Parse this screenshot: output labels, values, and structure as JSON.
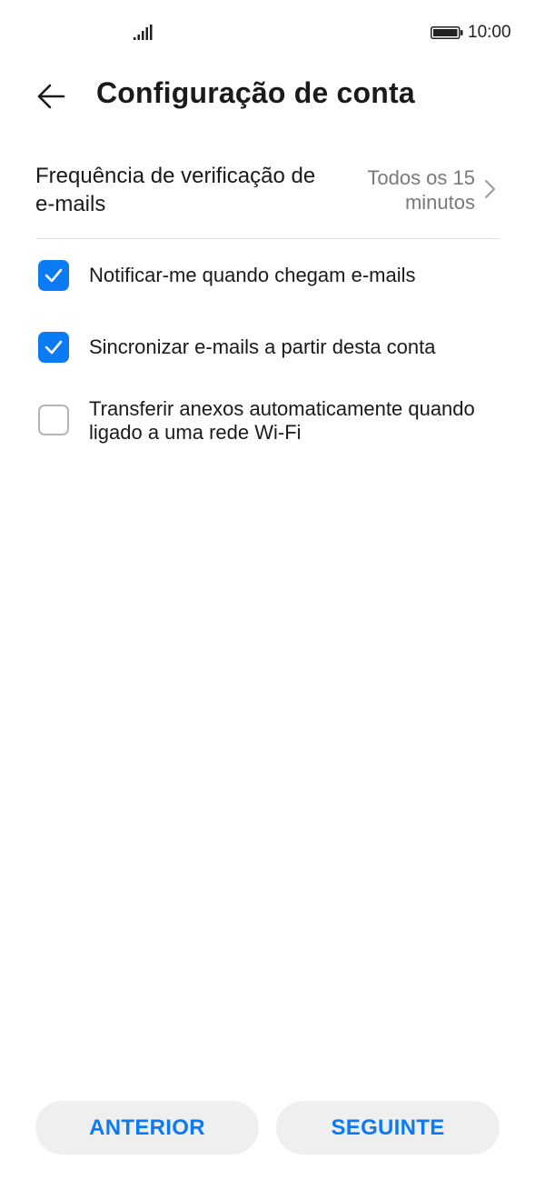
{
  "status_bar": {
    "time": "10:00"
  },
  "header": {
    "title": "Configuração de conta"
  },
  "settings": {
    "frequency": {
      "label": "Frequência de verificação de e-mails",
      "value": "Todos os 15 minutos"
    },
    "options": [
      {
        "label": "Notificar-me quando chegam e-mails",
        "checked": true
      },
      {
        "label": "Sincronizar e-mails a partir desta conta",
        "checked": true
      },
      {
        "label": "Transferir anexos automaticamente quando ligado a uma rede Wi-Fi",
        "checked": false
      }
    ]
  },
  "footer": {
    "back_label": "ANTERIOR",
    "next_label": "SEGUINTE"
  },
  "colors": {
    "accent": "#0a7bf5",
    "button_bg": "#efefef",
    "secondary_text": "#7a7a7a"
  }
}
